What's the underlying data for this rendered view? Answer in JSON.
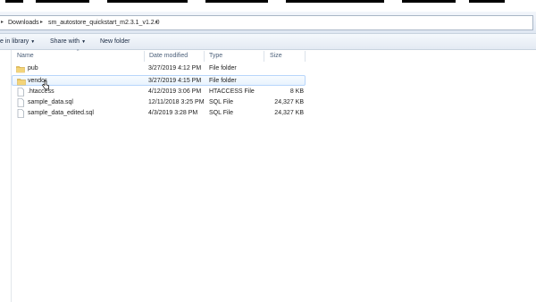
{
  "address_bar": {
    "crumbs": [
      "Downloads",
      "sm_autostore_quickstart_m2.3.1_v1.2.0"
    ]
  },
  "toolbar": {
    "include_label": "e in library",
    "share_label": "Share with",
    "new_folder_label": "New folder"
  },
  "columns": {
    "name": "Name",
    "date": "Date modified",
    "type": "Type",
    "size": "Size"
  },
  "files": [
    {
      "name": "pub",
      "date": "3/27/2019 4:12 PM",
      "type": "File folder",
      "size": "",
      "icon": "folder-icon"
    },
    {
      "name": "vendor",
      "date": "3/27/2019 4:15 PM",
      "type": "File folder",
      "size": "",
      "icon": "folder-icon"
    },
    {
      "name": ".htaccess",
      "date": "4/12/2019 3:06 PM",
      "type": "HTACCESS File",
      "size": "8 KB",
      "icon": "file-icon"
    },
    {
      "name": "sample_data.sql",
      "date": "12/11/2018 3:25 PM",
      "type": "SQL File",
      "size": "24,327 KB",
      "icon": "file-icon"
    },
    {
      "name": "sample_data_edited.sql",
      "date": "4/3/2019 3:28 PM",
      "type": "SQL File",
      "size": "24,327 KB",
      "icon": "file-icon"
    }
  ],
  "colors": {
    "toolbar_text": "#1b2b44",
    "header_text": "#4c607a",
    "hover_border": "#b8d6fb",
    "folder": "#e8c25a"
  }
}
